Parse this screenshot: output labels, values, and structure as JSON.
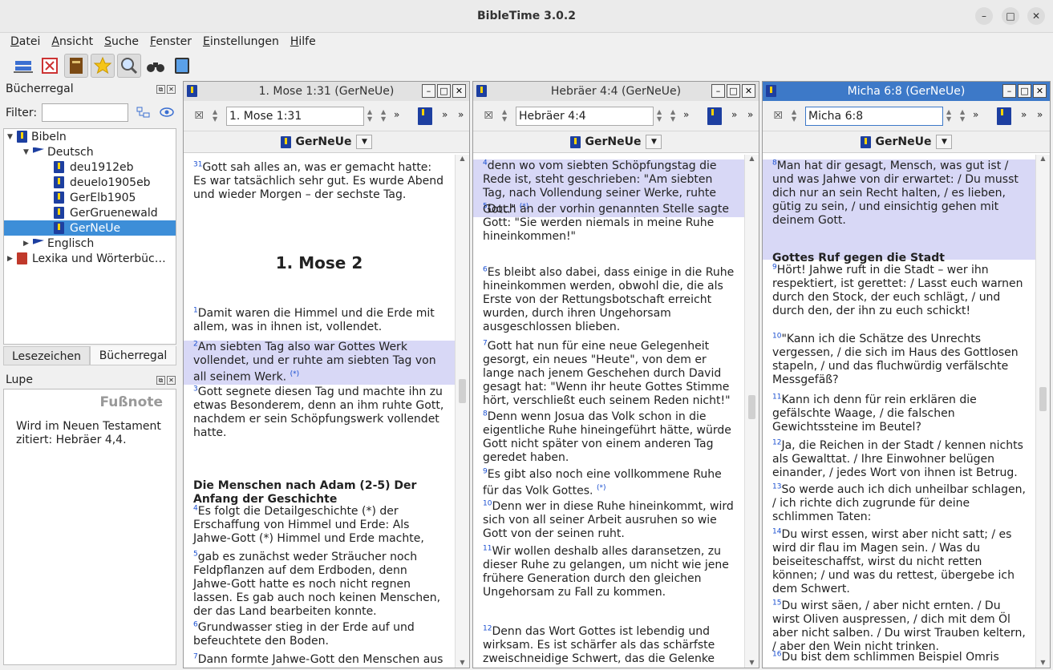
{
  "app": {
    "title": "BibleTime 3.0.2"
  },
  "menu": [
    "Datei",
    "Ansicht",
    "Suche",
    "Fenster",
    "Einstellungen",
    "Hilfe"
  ],
  "toolbar": {
    "icons": [
      "bookshelf-icon",
      "fullscreen-icon",
      "bookmark-book-icon",
      "star-icon",
      "magnifier-icon",
      "binoculars-icon",
      "tablet-icon"
    ]
  },
  "bookshelf": {
    "title": "Bücherregal",
    "filter_label": "Filter:",
    "filter_value": "",
    "tree": [
      {
        "label": "Bibeln",
        "level": 0,
        "expanded": true
      },
      {
        "label": "Deutsch",
        "level": 1,
        "expanded": true
      },
      {
        "label": "deu1912eb",
        "level": 2
      },
      {
        "label": "deuelo1905eb",
        "level": 2
      },
      {
        "label": "GerElb1905",
        "level": 2
      },
      {
        "label": "GerGruenewald",
        "level": 2
      },
      {
        "label": "GerNeUe",
        "level": 2,
        "selected": true
      },
      {
        "label": "Englisch",
        "level": 1,
        "expanded": false
      },
      {
        "label": "Lexika und Wörterbüc…",
        "level": 0,
        "expanded": false
      }
    ],
    "tabs": [
      "Lesezeichen",
      "Bücherregal"
    ]
  },
  "lupe": {
    "title": "Lupe",
    "heading": "Fußnote",
    "text": "Wird im Neuen Testament zitiert: Hebräer 4,4."
  },
  "windows": [
    {
      "title": "1. Mose 1:31 (GerNeUe)",
      "ref": "1. Mose 1:31",
      "module": "GerNeUe",
      "active": false,
      "blocks": [
        {
          "t": "v",
          "n": "31",
          "text": "Gott sah alles an, was er gemacht hatte: Es war tatsächlich sehr gut. Es wurde Abend und wieder Morgen – der sechste Tag."
        },
        {
          "t": "chap",
          "text": "1. Mose 2"
        },
        {
          "t": "v",
          "n": "1",
          "text": "Damit waren die Himmel und die Erde mit allem, was in ihnen ist, vollendet."
        },
        {
          "t": "v",
          "n": "2",
          "text": "Am siebten Tag also war Gottes Werk vollendet, und er ruhte am siebten Tag von all seinem Werk.",
          "fn": "(*)",
          "hl": true
        },
        {
          "t": "v",
          "n": "3",
          "text": "Gott segnete diesen Tag und machte ihn zu etwas Besonderem, denn an ihm ruhte Gott, nachdem er sein Schöpfungswerk vollendet hatte."
        },
        {
          "t": "head",
          "text": "Die Menschen nach Adam (2-5) Der Anfang der Geschichte"
        },
        {
          "t": "v",
          "n": "4",
          "text": "Es folgt die Detailgeschichte (*) der Erschaffung von Himmel und Erde: Als Jahwe-Gott (*) Himmel und Erde machte,"
        },
        {
          "t": "v",
          "n": "5",
          "text": "gab es zunächst weder Sträucher noch Feldpflanzen auf dem Erdboden, denn Jahwe-Gott hatte es noch nicht regnen lassen. Es gab auch noch keinen Menschen, der das Land bearbeiten konnte."
        },
        {
          "t": "v",
          "n": "6",
          "text": "Grundwasser stieg in der Erde auf und befeuchtete den Boden."
        },
        {
          "t": "v",
          "n": "7",
          "text": "Dann formte Jahwe-Gott den Menschen aus"
        }
      ]
    },
    {
      "title": "Hebräer 4:4 (GerNeUe)",
      "ref": "Hebräer 4:4",
      "module": "GerNeUe",
      "active": false,
      "blocks": [
        {
          "t": "v",
          "n": "4",
          "text": "denn wo vom siebten Schöpfungstag die Rede ist, steht geschrieben: \"Am siebten Tag, nach Vollendung seiner Werke, ruhte Gott.\"",
          "fn": "(*)",
          "hl": true
        },
        {
          "t": "v",
          "n": "5",
          "text": "Doch an der vorhin genannten Stelle sagte Gott: \"Sie werden niemals in meine Ruhe hineinkommen!\""
        },
        {
          "t": "v",
          "n": "6",
          "text": "Es bleibt also dabei, dass einige in die Ruhe hineinkommen werden, obwohl die, die als Erste von der Rettungsbotschaft erreicht wurden, durch ihren Ungehorsam ausgeschlossen blieben."
        },
        {
          "t": "v",
          "n": "7",
          "text": "Gott hat nun für eine neue Gelegenheit gesorgt, ein neues \"Heute\", von dem er lange nach jenem Geschehen durch David gesagt hat: \"Wenn ihr heute Gottes Stimme hört, verschließt euch seinem Reden nicht!\""
        },
        {
          "t": "v",
          "n": "8",
          "text": "Denn wenn Josua das Volk schon in die eigentliche Ruhe hineingeführt hätte, würde Gott nicht später von einem anderen Tag geredet haben."
        },
        {
          "t": "v",
          "n": "9",
          "text": "Es gibt also noch eine vollkommene Ruhe für das Volk Gottes.",
          "fn": "(*)"
        },
        {
          "t": "v",
          "n": "10",
          "text": "Denn wer in diese Ruhe hineinkommt, wird sich von all seiner Arbeit ausruhen so wie Gott von der seinen ruht."
        },
        {
          "t": "v",
          "n": "11",
          "text": "Wir wollen deshalb alles daransetzen, zu dieser Ruhe zu gelangen, um nicht wie jene frühere Generation durch den gleichen Ungehorsam zu Fall zu kommen."
        },
        {
          "t": "v",
          "n": "12",
          "text": "Denn das Wort Gottes ist lebendig und wirksam. Es ist schärfer als das schärfste zweischneidige Schwert, das die Gelenke"
        }
      ]
    },
    {
      "title": "Micha 6:8 (GerNeUe)",
      "ref": "Micha 6:8",
      "module": "GerNeUe",
      "active": true,
      "blocks": [
        {
          "t": "v",
          "n": "8",
          "text": "Man hat dir gesagt, Mensch, was gut ist / und was Jahwe von dir erwartet: / Du musst dich nur an sein Recht halten, / es lieben, gütig zu sein, / und einsichtig gehen mit deinem Gott.",
          "hl": true
        },
        {
          "t": "head",
          "text": "Gottes Ruf gegen die Stadt"
        },
        {
          "t": "v",
          "n": "9",
          "text": "Hört! Jahwe ruft in die Stadt – wer ihn respektiert, ist gerettet: / Lasst euch warnen durch den Stock, der euch schlägt, / und durch den, der ihn zu euch schickt!"
        },
        {
          "t": "v",
          "n": "10",
          "text": "\"Kann ich die Schätze des Unrechts vergessen, / die sich im Haus des Gottlosen stapeln, / und das fluchwürdig verfälschte Messgefäß?"
        },
        {
          "t": "v",
          "n": "11",
          "text": "Kann ich denn für rein erklären die gefälschte Waage, / die falschen Gewichtssteine im Beutel?"
        },
        {
          "t": "v",
          "n": "12",
          "text": "Ja, die Reichen in der Stadt / kennen nichts als Gewalttat. / Ihre Einwohner belügen einander, / jedes Wort von ihnen ist Betrug."
        },
        {
          "t": "v",
          "n": "13",
          "text": "So werde auch ich dich unheilbar schlagen, / ich richte dich zugrunde für deine schlimmen Taten:"
        },
        {
          "t": "v",
          "n": "14",
          "text": "Du wirst essen, wirst aber nicht satt; / es wird dir flau im Magen sein. / Was du beiseiteschaffst, wirst du nicht retten können; / und was du rettest, übergebe ich dem Schwert."
        },
        {
          "t": "v",
          "n": "15",
          "text": "Du wirst säen, / aber nicht ernten. / Du wirst Oliven auspressen, / dich mit dem Öl aber nicht salben. / Du wirst Trauben keltern, / aber den Wein nicht trinken."
        },
        {
          "t": "v",
          "n": "16",
          "text": "Du bist dem schlimmen Beispiel Omris"
        }
      ]
    }
  ]
}
